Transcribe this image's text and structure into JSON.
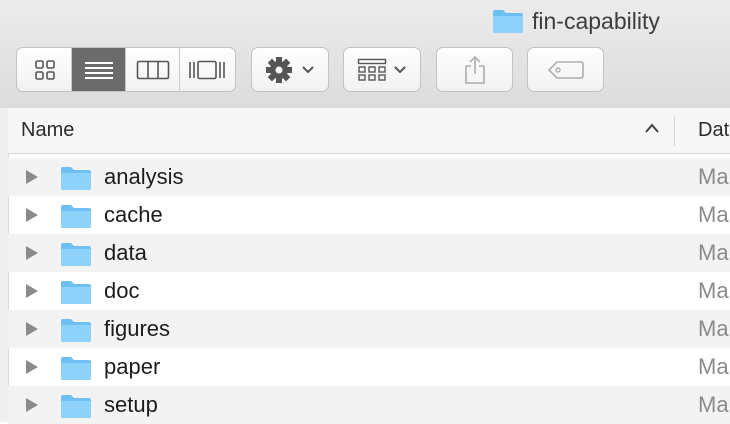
{
  "window": {
    "title": "fin-capability"
  },
  "toolbar": {
    "view_buttons": [
      "icon-view",
      "list-view",
      "column-view",
      "gallery-view"
    ],
    "active_view": "list-view"
  },
  "columns": {
    "name": "Name",
    "date": "Dat"
  },
  "rows": [
    {
      "name": "analysis",
      "date": "Ma"
    },
    {
      "name": "cache",
      "date": "Ma"
    },
    {
      "name": "data",
      "date": "Ma"
    },
    {
      "name": "doc",
      "date": "Ma"
    },
    {
      "name": "figures",
      "date": "Ma"
    },
    {
      "name": "paper",
      "date": "Ma"
    },
    {
      "name": "setup",
      "date": "Ma"
    }
  ],
  "colors": {
    "folder": "#7cc8f5",
    "active_segment": "#6b6b6b"
  }
}
